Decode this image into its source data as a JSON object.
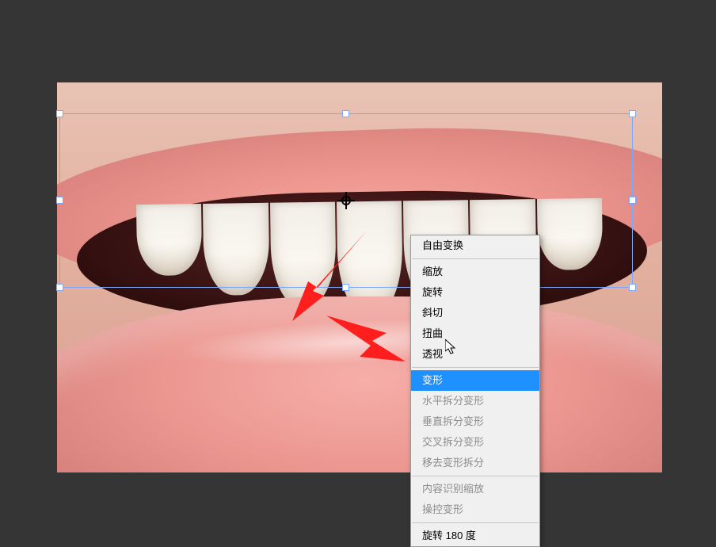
{
  "menu": {
    "free_transform": "自由变换",
    "scale": "缩放",
    "rotate": "旋转",
    "skew": "斜切",
    "distort": "扭曲",
    "perspective": "透视",
    "warp": "变形",
    "split_warp_h": "水平拆分变形",
    "split_warp_v": "垂直拆分变形",
    "split_warp_cross": "交叉拆分变形",
    "remove_warp_split": "移去变形拆分",
    "content_aware_scale": "内容识别缩放",
    "puppet_warp": "操控变形",
    "rotate_180": "旋转 180 度"
  },
  "selected_menu_item": "warp"
}
